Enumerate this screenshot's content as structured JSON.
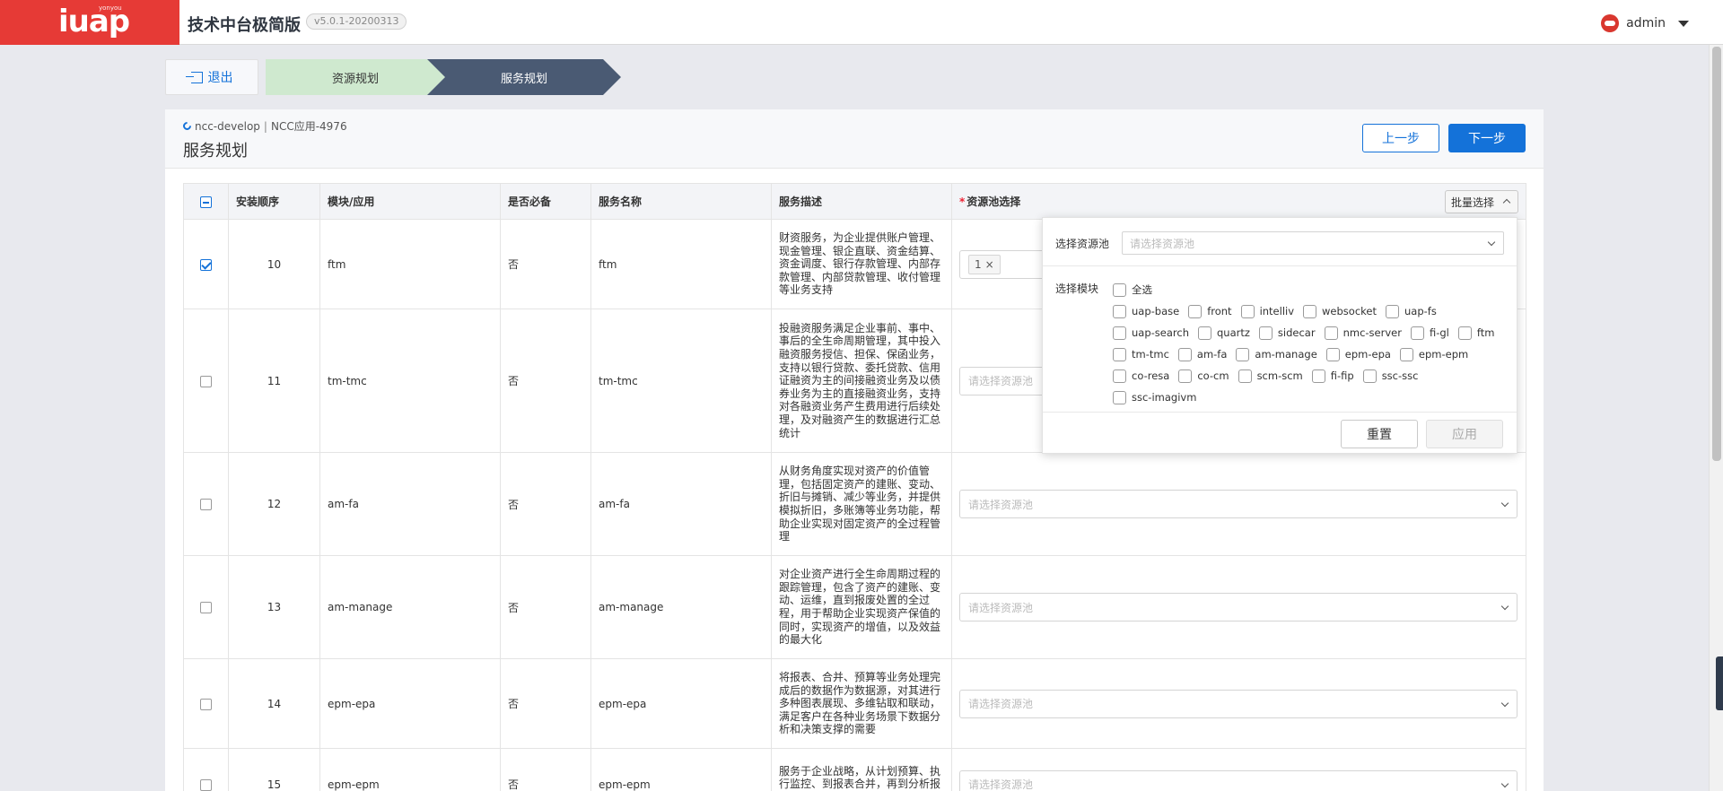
{
  "header": {
    "logo_text": "iuap",
    "logo_small": "yonyou",
    "app_title": "技术中台极简版",
    "version": "v5.0.1-20200313",
    "user": "admin"
  },
  "steps": {
    "exit_label": "退出",
    "items": [
      {
        "label": "资源规划",
        "state": "done"
      },
      {
        "label": "服务规划",
        "state": "active"
      }
    ]
  },
  "card": {
    "crumb_env": "ncc-develop",
    "crumb_sep": "|",
    "crumb_app": "NCC应用-4976",
    "title": "服务规划",
    "prev_label": "上一步",
    "next_label": "下一步"
  },
  "table": {
    "columns": [
      "安装顺序",
      "模块/应用",
      "是否必备",
      "服务名称",
      "服务描述",
      "资源池选择"
    ],
    "required_mark": "*",
    "batch_label": "批量选择",
    "select_placeholder": "请选择资源池",
    "rows": [
      {
        "checked": true,
        "order": "10",
        "module": "ftm",
        "required": "否",
        "service": "ftm",
        "desc": "财资服务，为企业提供账户管理、现金管理、银企直联、资金结算、资金调度、银行存款管理、内部存款管理、内部贷款管理、收付管理等业务支持",
        "tag": "1",
        "tag_close": "×"
      },
      {
        "checked": false,
        "order": "11",
        "module": "tm-tmc",
        "required": "否",
        "service": "tm-tmc",
        "desc": "投融资服务满足企业事前、事中、事后的全生命周期管理，其中投入融资服务授信、担保、保函业务，支持以银行贷款、委托贷款、信用证融资为主的间接融资业务及以债券业务为主的直接融资业务，支持对各融资业务产生费用进行后续处理，及对融资产生的数据进行汇总统计"
      },
      {
        "checked": false,
        "order": "12",
        "module": "am-fa",
        "required": "否",
        "service": "am-fa",
        "desc": "从财务角度实现对资产的价值管理，包括固定资产的建账、变动、折旧与摊销、减少等业务，并提供模拟折旧，多账簿等业务功能，帮助企业实现对固定资产的全过程管理"
      },
      {
        "checked": false,
        "order": "13",
        "module": "am-manage",
        "required": "否",
        "service": "am-manage",
        "desc": "对企业资产进行全生命周期过程的跟踪管理，包含了资产的建账、变动、运维，直到报废处置的全过程，用于帮助企业实现资产保值的同时，实现资产的增值，以及效益的最大化"
      },
      {
        "checked": false,
        "order": "14",
        "module": "epm-epa",
        "required": "否",
        "service": "epm-epa",
        "desc": "将报表、合并、预算等业务处理完成后的数据作为数据源，对其进行多种图表展现、多维钻取和联动，满足客户在各种业务场景下数据分析和决策支撑的需要"
      },
      {
        "checked": false,
        "order": "15",
        "module": "epm-epm",
        "required": "否",
        "service": "epm-epm",
        "desc": "服务于企业战略，从计划预算、执行监控、到报表合并，再到分析报告，从价值创造的角度对管理..."
      }
    ]
  },
  "popover": {
    "pool_label": "选择资源池",
    "pool_placeholder": "请选择资源池",
    "modules_label": "选择模块",
    "select_all": "全选",
    "module_rows": [
      [
        "uap-base",
        "front",
        "intelliv",
        "websocket",
        "uap-fs"
      ],
      [
        "uap-search",
        "quartz",
        "sidecar",
        "nmc-server",
        "fi-gl",
        "ftm"
      ],
      [
        "tm-tmc",
        "am-fa",
        "am-manage",
        "epm-epa",
        "epm-epm"
      ],
      [
        "co-resa",
        "co-cm",
        "scm-scm",
        "fi-fip",
        "ssc-ssc"
      ],
      [
        "ssc-imagivm"
      ]
    ],
    "reset_label": "重置",
    "apply_label": "应用"
  }
}
